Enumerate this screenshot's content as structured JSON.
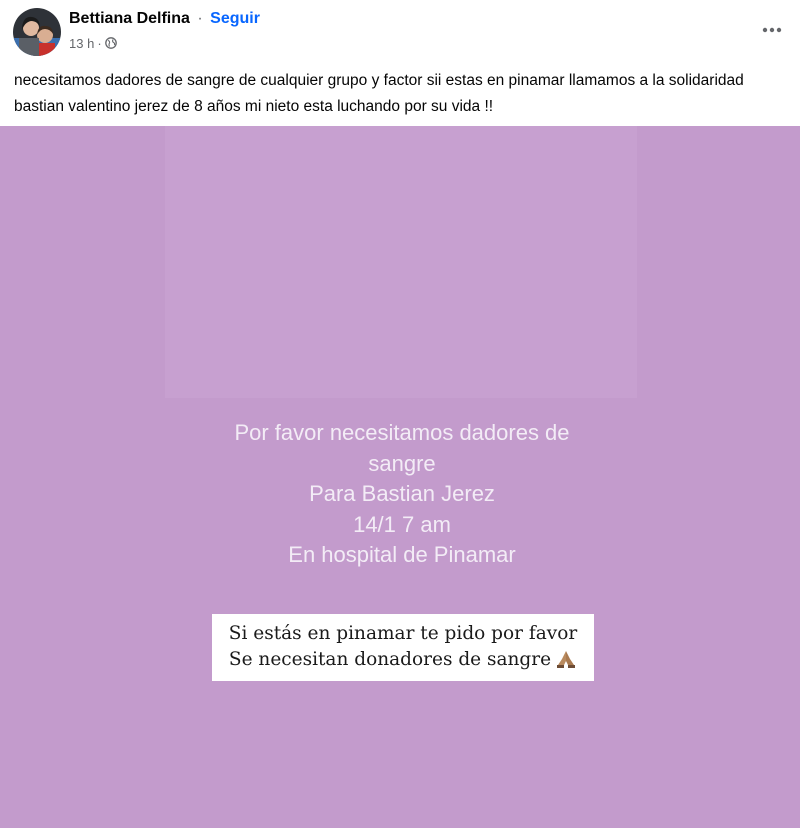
{
  "post": {
    "author_name": "Bettiana Delfina",
    "separator": "·",
    "follow_label": "Seguir",
    "timestamp": "13 h",
    "meta_separator": "·",
    "audience_icon": "globe-icon",
    "more_icon": "more-options-icon",
    "text": "necesitamos dadores de sangre de cualquier grupo y factor sii estas en pinamar llamamos a la solidaridad bastian valentino jerez de 8 años mi nieto esta luchando por su vida !!"
  },
  "image": {
    "background_color": "#c39bcc",
    "lines": [
      "Por favor necesitamos dadores de",
      "sangre",
      "Para Bastian Jerez",
      "14/1 7 am",
      "En hospital de Pinamar"
    ],
    "caption": {
      "line1": "Si estás en pinamar te pido por favor",
      "line2": "Se necesitan donadores de sangre",
      "emoji_icon": "praying-hands-icon"
    }
  },
  "colors": {
    "link": "#0866ff",
    "secondary_text": "#65676b"
  }
}
